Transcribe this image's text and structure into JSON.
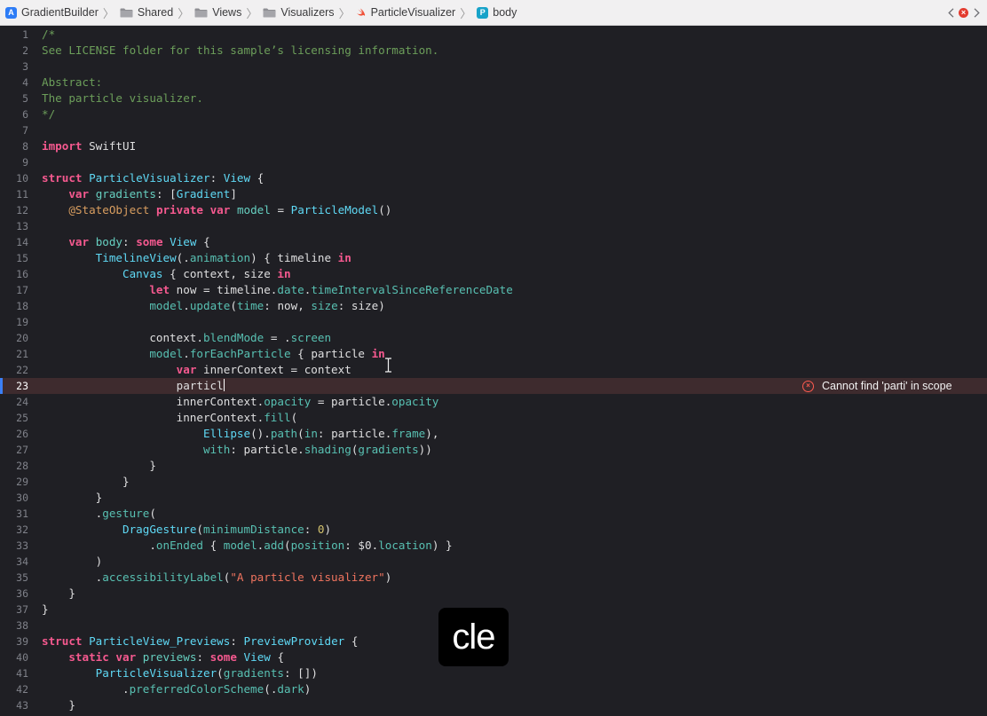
{
  "jumpbar": {
    "crumbs": [
      {
        "label": "GradientBuilder",
        "icon": "app-icon"
      },
      {
        "label": "Shared",
        "icon": "folder-icon"
      },
      {
        "label": "Views",
        "icon": "folder-icon"
      },
      {
        "label": "Visualizers",
        "icon": "folder-icon"
      },
      {
        "label": "ParticleVisualizer",
        "icon": "swift-file-icon"
      },
      {
        "label": "body",
        "icon": "property-icon"
      }
    ],
    "app_glyph": "A",
    "property_glyph": "P"
  },
  "editor": {
    "caret_line": 23,
    "lines": [
      [
        [
          "cm",
          "/*"
        ]
      ],
      [
        [
          "cm",
          "See LICENSE folder for this sample’s licensing information."
        ]
      ],
      [],
      [
        [
          "cm",
          "Abstract:"
        ]
      ],
      [
        [
          "cm",
          "The particle visualizer."
        ]
      ],
      [
        [
          "cm",
          "*/"
        ]
      ],
      [],
      [
        [
          "kw",
          "import"
        ],
        [
          "pl",
          " SwiftUI"
        ]
      ],
      [],
      [
        [
          "kw",
          "struct"
        ],
        [
          "pl",
          " "
        ],
        [
          "ty",
          "ParticleVisualizer"
        ],
        [
          "pl",
          ": "
        ],
        [
          "ty",
          "View"
        ],
        [
          "pl",
          " {"
        ]
      ],
      [
        [
          "pl",
          "    "
        ],
        [
          "kw",
          "var"
        ],
        [
          "pl",
          " "
        ],
        [
          "pr",
          "gradients"
        ],
        [
          "pl",
          ": ["
        ],
        [
          "ty",
          "Gradient"
        ],
        [
          "pl",
          "]"
        ]
      ],
      [
        [
          "pl",
          "    "
        ],
        [
          "at",
          "@StateObject"
        ],
        [
          "pl",
          " "
        ],
        [
          "kw",
          "private var"
        ],
        [
          "pl",
          " "
        ],
        [
          "pr",
          "model"
        ],
        [
          "pl",
          " = "
        ],
        [
          "ty",
          "ParticleModel"
        ],
        [
          "pl",
          "()"
        ]
      ],
      [],
      [
        [
          "pl",
          "    "
        ],
        [
          "kw",
          "var"
        ],
        [
          "pl",
          " "
        ],
        [
          "pr",
          "body"
        ],
        [
          "pl",
          ": "
        ],
        [
          "kw",
          "some"
        ],
        [
          "pl",
          " "
        ],
        [
          "ty",
          "View"
        ],
        [
          "pl",
          " {"
        ]
      ],
      [
        [
          "pl",
          "        "
        ],
        [
          "ty",
          "TimelineView"
        ],
        [
          "pl",
          "(."
        ],
        [
          "fn",
          "animation"
        ],
        [
          "pl",
          ") { timeline "
        ],
        [
          "kw",
          "in"
        ]
      ],
      [
        [
          "pl",
          "            "
        ],
        [
          "ty",
          "Canvas"
        ],
        [
          "pl",
          " { context, size "
        ],
        [
          "kw",
          "in"
        ]
      ],
      [
        [
          "pl",
          "                "
        ],
        [
          "kw",
          "let"
        ],
        [
          "pl",
          " now = timeline."
        ],
        [
          "fn",
          "date"
        ],
        [
          "pl",
          "."
        ],
        [
          "fn",
          "timeIntervalSinceReferenceDate"
        ]
      ],
      [
        [
          "pl",
          "                "
        ],
        [
          "fn",
          "model"
        ],
        [
          "pl",
          "."
        ],
        [
          "fn",
          "update"
        ],
        [
          "pl",
          "("
        ],
        [
          "fn",
          "time"
        ],
        [
          "pl",
          ": now, "
        ],
        [
          "fn",
          "size"
        ],
        [
          "pl",
          ": size)"
        ]
      ],
      [],
      [
        [
          "pl",
          "                context."
        ],
        [
          "fn",
          "blendMode"
        ],
        [
          "pl",
          " = ."
        ],
        [
          "fn",
          "screen"
        ]
      ],
      [
        [
          "pl",
          "                "
        ],
        [
          "fn",
          "model"
        ],
        [
          "pl",
          "."
        ],
        [
          "fn",
          "forEachParticle"
        ],
        [
          "pl",
          " { particle "
        ],
        [
          "kw",
          "in"
        ]
      ],
      [
        [
          "pl",
          "                    "
        ],
        [
          "kw",
          "var"
        ],
        [
          "pl",
          " innerContext = context"
        ]
      ],
      [
        [
          "pl",
          "                    particl"
        ]
      ],
      [
        [
          "pl",
          "                    innerContext."
        ],
        [
          "fn",
          "opacity"
        ],
        [
          "pl",
          " = particle."
        ],
        [
          "fn",
          "opacity"
        ]
      ],
      [
        [
          "pl",
          "                    innerContext."
        ],
        [
          "fn",
          "fill"
        ],
        [
          "pl",
          "("
        ]
      ],
      [
        [
          "pl",
          "                        "
        ],
        [
          "ty",
          "Ellipse"
        ],
        [
          "pl",
          "()."
        ],
        [
          "fn",
          "path"
        ],
        [
          "pl",
          "("
        ],
        [
          "fn",
          "in"
        ],
        [
          "pl",
          ": particle."
        ],
        [
          "fn",
          "frame"
        ],
        [
          "pl",
          "),"
        ]
      ],
      [
        [
          "pl",
          "                        "
        ],
        [
          "fn",
          "with"
        ],
        [
          "pl",
          ": particle."
        ],
        [
          "fn",
          "shading"
        ],
        [
          "pl",
          "("
        ],
        [
          "fn",
          "gradients"
        ],
        [
          "pl",
          "))"
        ]
      ],
      [
        [
          "pl",
          "                }"
        ]
      ],
      [
        [
          "pl",
          "            }"
        ]
      ],
      [
        [
          "pl",
          "        }"
        ]
      ],
      [
        [
          "pl",
          "        ."
        ],
        [
          "fn",
          "gesture"
        ],
        [
          "pl",
          "("
        ]
      ],
      [
        [
          "pl",
          "            "
        ],
        [
          "ty",
          "DragGesture"
        ],
        [
          "pl",
          "("
        ],
        [
          "fn",
          "minimumDistance"
        ],
        [
          "pl",
          ": "
        ],
        [
          "nm",
          "0"
        ],
        [
          "pl",
          ")"
        ]
      ],
      [
        [
          "pl",
          "                ."
        ],
        [
          "fn",
          "onEnded"
        ],
        [
          "pl",
          " { "
        ],
        [
          "fn",
          "model"
        ],
        [
          "pl",
          "."
        ],
        [
          "fn",
          "add"
        ],
        [
          "pl",
          "("
        ],
        [
          "fn",
          "position"
        ],
        [
          "pl",
          ": $0."
        ],
        [
          "fn",
          "location"
        ],
        [
          "pl",
          ") }"
        ]
      ],
      [
        [
          "pl",
          "        )"
        ]
      ],
      [
        [
          "pl",
          "        ."
        ],
        [
          "fn",
          "accessibilityLabel"
        ],
        [
          "pl",
          "("
        ],
        [
          "st",
          "\"A particle visualizer\""
        ],
        [
          "pl",
          ")"
        ]
      ],
      [
        [
          "pl",
          "    }"
        ]
      ],
      [
        [
          "pl",
          "}"
        ]
      ],
      [],
      [
        [
          "kw",
          "struct"
        ],
        [
          "pl",
          " "
        ],
        [
          "ty",
          "ParticleView_Previews"
        ],
        [
          "pl",
          ": "
        ],
        [
          "ty",
          "PreviewProvider"
        ],
        [
          "pl",
          " {"
        ]
      ],
      [
        [
          "pl",
          "    "
        ],
        [
          "kw",
          "static var"
        ],
        [
          "pl",
          " "
        ],
        [
          "pr",
          "previews"
        ],
        [
          "pl",
          ": "
        ],
        [
          "kw",
          "some"
        ],
        [
          "pl",
          " "
        ],
        [
          "ty",
          "View"
        ],
        [
          "pl",
          " {"
        ]
      ],
      [
        [
          "pl",
          "        "
        ],
        [
          "ty",
          "ParticleVisualizer"
        ],
        [
          "pl",
          "("
        ],
        [
          "fn",
          "gradients"
        ],
        [
          "pl",
          ": [])"
        ]
      ],
      [
        [
          "pl",
          "            ."
        ],
        [
          "fn",
          "preferredColorScheme"
        ],
        [
          "pl",
          "(."
        ],
        [
          "fn",
          "dark"
        ],
        [
          "pl",
          ")"
        ]
      ],
      [
        [
          "pl",
          "    }"
        ]
      ]
    ]
  },
  "error": {
    "line": 23,
    "icon": "error-circle-icon",
    "glyph": "×",
    "message": "Cannot find 'parti' in scope"
  },
  "keystroke_overlay": {
    "text": "cle"
  },
  "colors": {
    "background": "#1f1f24",
    "keyword": "#f5598f",
    "type": "#5fd9f5",
    "comment": "#6c9e5a",
    "string": "#f0745f",
    "error": "#ff5b50"
  }
}
